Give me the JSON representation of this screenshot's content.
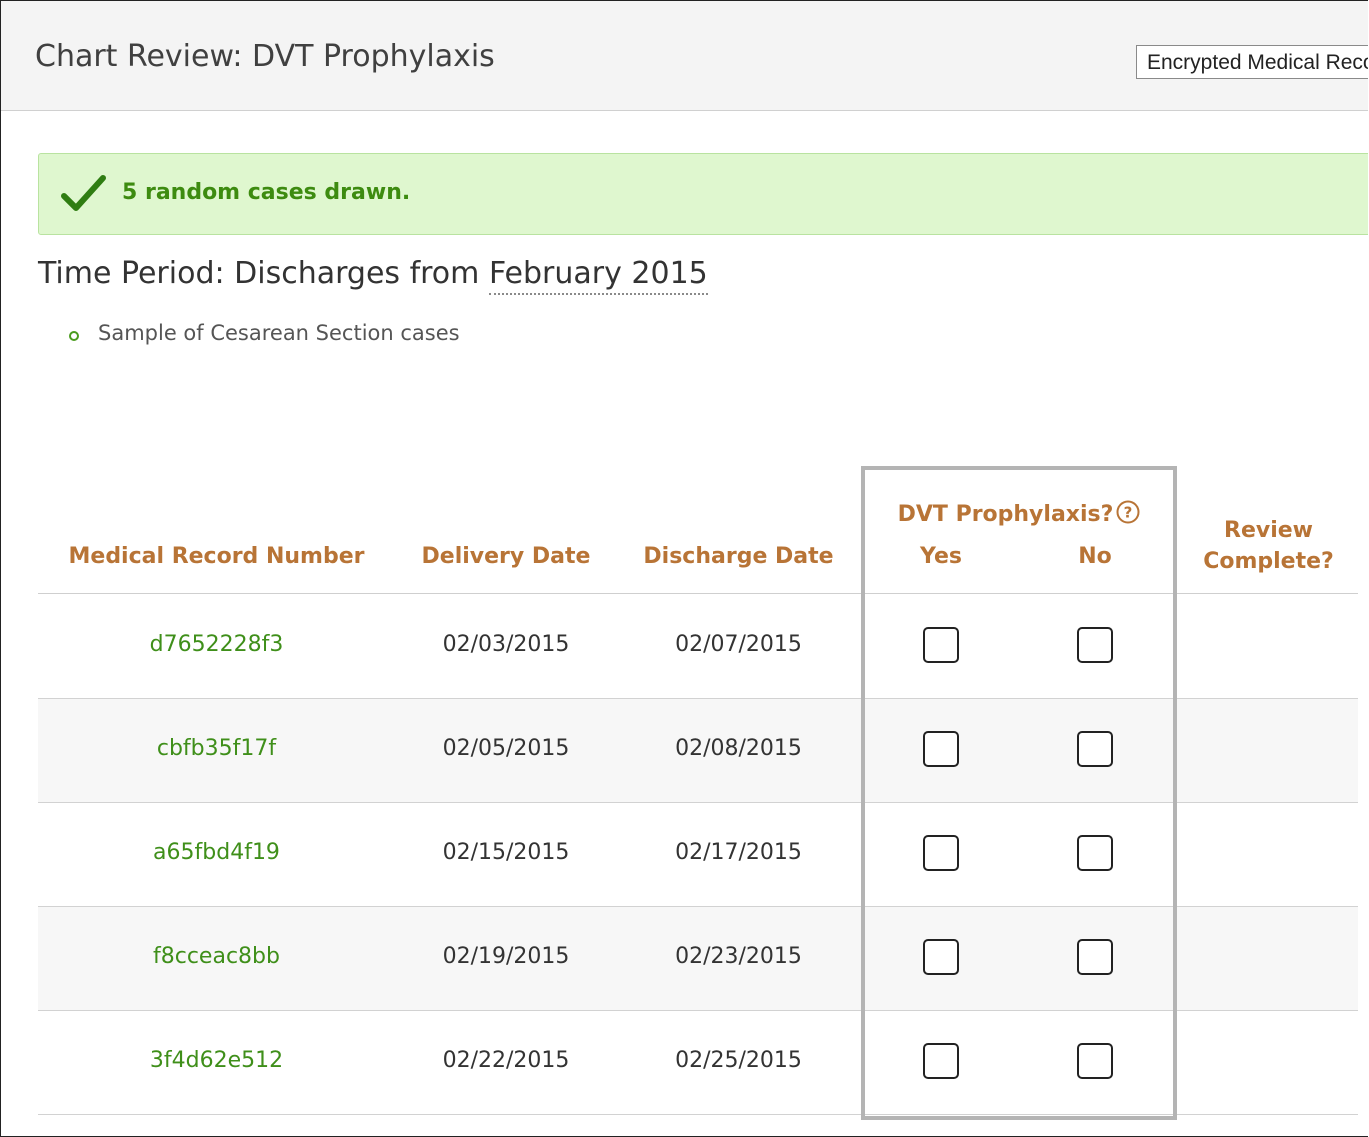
{
  "header": {
    "title": "Chart Review: DVT Prophylaxis",
    "encryption_select": "Encrypted Medical Record Number"
  },
  "alert": {
    "message": "5 random cases drawn.",
    "icon": "check-icon",
    "color": "#3d8b10"
  },
  "time_period": {
    "prefix": "Time Period: Discharges from ",
    "month": "February 2015"
  },
  "notes": [
    "Sample of Cesarean Section cases"
  ],
  "table": {
    "headers": {
      "mrn": "Medical Record Number",
      "delivery": "Delivery Date",
      "discharge": "Discharge Date",
      "dvt_group": "DVT Prophylaxis?",
      "help_icon": "?",
      "yes": "Yes",
      "no": "No",
      "review_line1": "Review",
      "review_line2": "Complete?"
    },
    "rows": [
      {
        "mrn": "d7652228f3",
        "delivery": "02/03/2015",
        "discharge": "02/07/2015",
        "yes": false,
        "no": false
      },
      {
        "mrn": "cbfb35f17f",
        "delivery": "02/05/2015",
        "discharge": "02/08/2015",
        "yes": false,
        "no": false
      },
      {
        "mrn": "a65fbd4f19",
        "delivery": "02/15/2015",
        "discharge": "02/17/2015",
        "yes": false,
        "no": false
      },
      {
        "mrn": "f8cceac8bb",
        "delivery": "02/19/2015",
        "discharge": "02/23/2015",
        "yes": false,
        "no": false
      },
      {
        "mrn": "3f4d62e512",
        "delivery": "02/22/2015",
        "discharge": "02/25/2015",
        "yes": false,
        "no": false
      }
    ]
  },
  "colors": {
    "header_text": "#b87436",
    "mrn_link": "#3f8f1a",
    "alert_bg": "#dff7cf"
  }
}
